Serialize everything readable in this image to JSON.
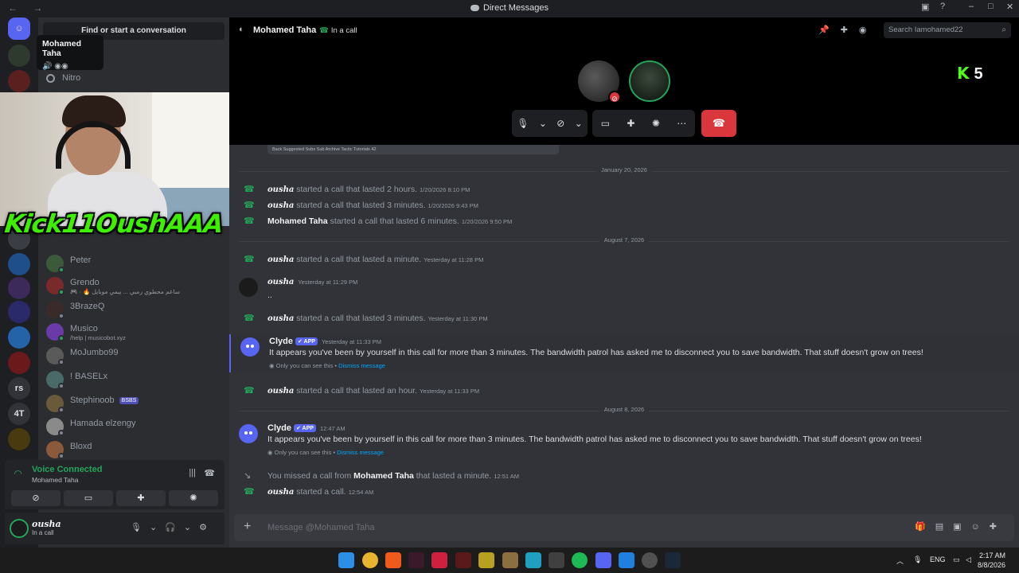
{
  "titlebar": {
    "title": "Direct Messages",
    "nav": "← →"
  },
  "dm_search": {
    "label": "Find or start a conversation"
  },
  "tooltip": {
    "name": "Mohamed Taha"
  },
  "nitro": {
    "label": "Nitro"
  },
  "overlay": {
    "kick_text": "Kick11OushAAA"
  },
  "servers": [
    {
      "label": "rs"
    },
    {
      "label": "4T"
    }
  ],
  "dm_list": [
    {
      "name": "Peter",
      "sub": "",
      "badge": ""
    },
    {
      "name": "Grendo",
      "sub": "🎮 · 🔥 ساعم محطوي رمبي ... يبمي موبايل",
      "badge": ""
    },
    {
      "name": "3BrazeQ",
      "sub": "",
      "badge": ""
    },
    {
      "name": "Musico",
      "sub": "/help | musicobot.xyz",
      "badge": ""
    },
    {
      "name": "MoJumbo99",
      "sub": "",
      "badge": ""
    },
    {
      "name": "! BASELx",
      "sub": "",
      "badge": ""
    },
    {
      "name": "Stephinoob",
      "sub": "",
      "badge": "BSBS"
    },
    {
      "name": "Hamada elzengy",
      "sub": "",
      "badge": ""
    },
    {
      "name": "Bloxd",
      "sub": "",
      "badge": ""
    }
  ],
  "voice": {
    "status": "Voice Connected",
    "channel": "Mohamed Taha"
  },
  "user": {
    "name": "ousha",
    "status": "In a call"
  },
  "header": {
    "name": "Mohamed Taha",
    "call_status": "In a call",
    "search_placeholder": "Search Iamohamed22"
  },
  "kick_badge": {
    "value": "5"
  },
  "chat": {
    "peek_text": "Back   Suggested Subs   Sub Archive Tactic   Tutorials          42",
    "dividers": [
      "January 20, 2026",
      "August 7, 2026",
      "August 8, 2026"
    ],
    "calls": [
      {
        "user": "ousha",
        "text": "started a call that lasted 2 hours.",
        "time": "1/20/2026 8:10 PM"
      },
      {
        "user": "ousha",
        "text": "started a call that lasted 3 minutes.",
        "time": "1/20/2026 9:43 PM"
      },
      {
        "user": "Mohamed Taha",
        "text": "started a call that lasted 6 minutes.",
        "time": "1/20/2026 9:50 PM"
      },
      {
        "user": "ousha",
        "text": "started a call that lasted a minute.",
        "time": "Yesterday at 11:28 PM"
      },
      {
        "user": "ousha",
        "text": "started a call that lasted 3 minutes.",
        "time": "Yesterday at 11:30 PM"
      },
      {
        "user": "ousha",
        "text": "started a call that lasted an hour.",
        "time": "Yesterday at 11:33 PM"
      },
      {
        "user": "ousha",
        "text": "started a call.",
        "time": "12:54 AM"
      }
    ],
    "missed": {
      "prefix": "You missed a call from",
      "user": "Mohamed Taha",
      "suffix": "that lasted a minute.",
      "time": "12:51 AM"
    },
    "ousha_msg": {
      "user": "ousha",
      "time": "Yesterday at 11:29 PM",
      "body": ".."
    },
    "clyde_1": {
      "user": "Clyde",
      "tag": "APP",
      "time": "Yesterday at 11:33 PM",
      "body": "It appears you've been by yourself in this call for more than 3 minutes. The bandwidth patrol has asked me to disconnect you to save bandwidth. That stuff doesn't grow on trees!",
      "note": "Only you can see this •",
      "dismiss": "Dismiss message"
    },
    "clyde_2": {
      "user": "Clyde",
      "tag": "APP",
      "time": "12:47 AM",
      "body": "It appears you've been by yourself in this call for more than 3 minutes. The bandwidth patrol has asked me to disconnect you to save bandwidth. That stuff doesn't grow on trees!",
      "note": "Only you can see this •",
      "dismiss": "Dismiss message"
    }
  },
  "composer": {
    "placeholder": "Message @Mohamed Taha"
  },
  "taskbar": {
    "lang": "ENG",
    "time": "2:17 AM",
    "date": "8/8/2026"
  },
  "colors": {
    "accent": "#5865f2",
    "online": "#23a55a",
    "danger": "#da373c",
    "kick": "#53fc18"
  }
}
